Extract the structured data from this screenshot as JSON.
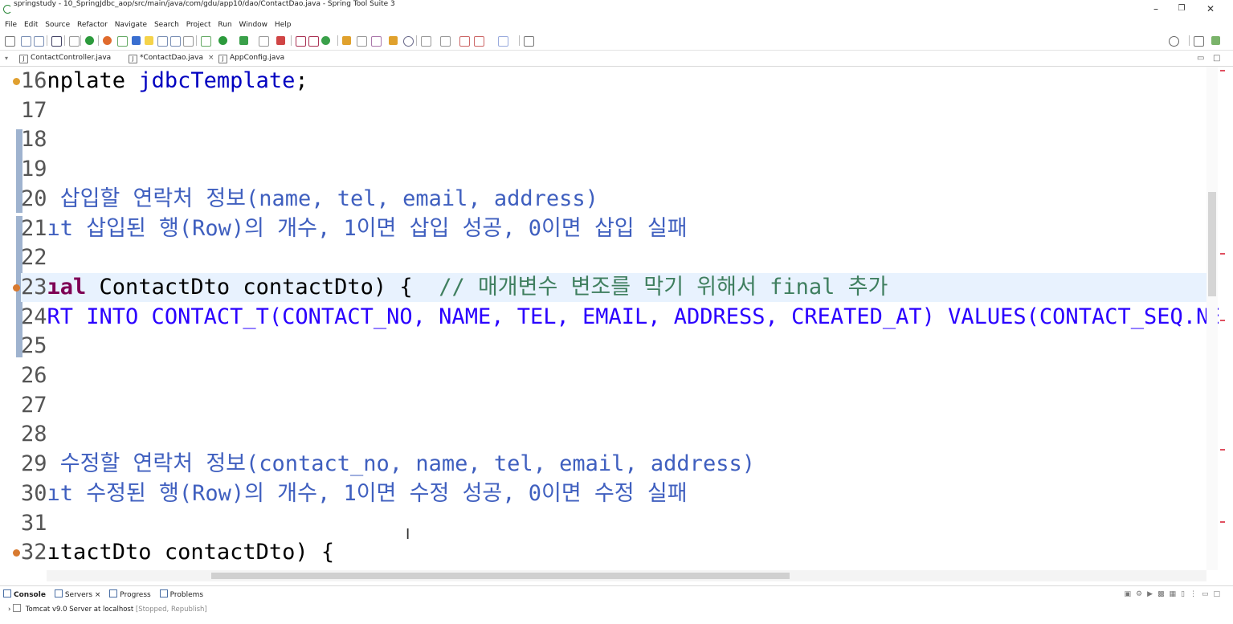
{
  "window": {
    "title": "springstudy - 10_SpringJdbc_aop/src/main/java/com/gdu/app10/dao/ContactDao.java - Spring Tool Suite 3",
    "minimize": "–",
    "maximize": "❐",
    "close": "✕"
  },
  "menu": [
    "File",
    "Edit",
    "Source",
    "Refactor",
    "Navigate",
    "Search",
    "Project",
    "Run",
    "Window",
    "Help"
  ],
  "tabs": [
    {
      "label": "ContactController.java",
      "active": false
    },
    {
      "label": "*ContactDao.java",
      "active": true,
      "close": "×"
    },
    {
      "label": "AppConfig.java",
      "active": false
    }
  ],
  "editor": {
    "lines": [
      {
        "no": "16",
        "segments": [
          {
            "t": "nplate ",
            "c": "n"
          },
          {
            "t": "jdbcTemplate",
            "c": "f"
          },
          {
            "t": ";",
            "c": "n"
          }
        ]
      },
      {
        "no": "17",
        "segments": []
      },
      {
        "no": "18",
        "segments": []
      },
      {
        "no": "19",
        "segments": []
      },
      {
        "no": "20",
        "segments": [
          {
            "t": " 삽입할 연락처 정보(name, tel, email, address)",
            "c": "c"
          }
        ]
      },
      {
        "no": "21",
        "segments": [
          {
            "t": "ıt 삽입된 행(Row)의 개수, 1이면 삽입 성공, 0이면 삽입 실패",
            "c": "c"
          }
        ]
      },
      {
        "no": "22",
        "segments": []
      },
      {
        "no": "23",
        "segments": [
          {
            "t": "ıal ",
            "c": "k"
          },
          {
            "t": "ContactDto ",
            "c": "n"
          },
          {
            "t": "contactDto",
            "c": "n"
          },
          {
            "t": ") {  ",
            "c": "n"
          },
          {
            "t": "// 매개변수 변조를 막기 위해서 final 추가",
            "c": "c2"
          }
        ]
      },
      {
        "no": "24",
        "segments": [
          {
            "t": "RT INTO CONTACT_T(CONTACT_NO, NAME, TEL, EMAIL, ADDRESS, CREATED_AT) VALUES(CONTACT_SEQ.NEX",
            "c": "s"
          }
        ]
      },
      {
        "no": "25",
        "segments": []
      },
      {
        "no": "26",
        "segments": []
      },
      {
        "no": "27",
        "segments": []
      },
      {
        "no": "28",
        "segments": []
      },
      {
        "no": "29",
        "segments": [
          {
            "t": " 수정할 연락처 정보(contact_no, name, tel, email, address)",
            "c": "c"
          }
        ]
      },
      {
        "no": "30",
        "segments": [
          {
            "t": "ıt 수정된 행(Row)의 개수, 1이면 수정 성공, 0이면 수정 실패",
            "c": "c"
          }
        ]
      },
      {
        "no": "31",
        "segments": []
      },
      {
        "no": "32",
        "segments": [
          {
            "t": "ıtactDto ",
            "c": "n"
          },
          {
            "t": "contactDto",
            "c": "n"
          },
          {
            "t": ") {",
            "c": "n"
          }
        ]
      }
    ],
    "current_line": "23"
  },
  "console": {
    "tabs": [
      "Console",
      "Servers",
      "Progress",
      "Problems"
    ],
    "active_tab": "Console",
    "server_name": "Tomcat v9.0 Server at localhost",
    "server_status": "[Stopped, Republish]"
  },
  "colors": {
    "comment": "#3f5fbf",
    "keyword": "#7f0055",
    "string": "#2a00ff",
    "line_comment": "#3f7f5f",
    "current_line_bg": "#e8f2fe"
  }
}
